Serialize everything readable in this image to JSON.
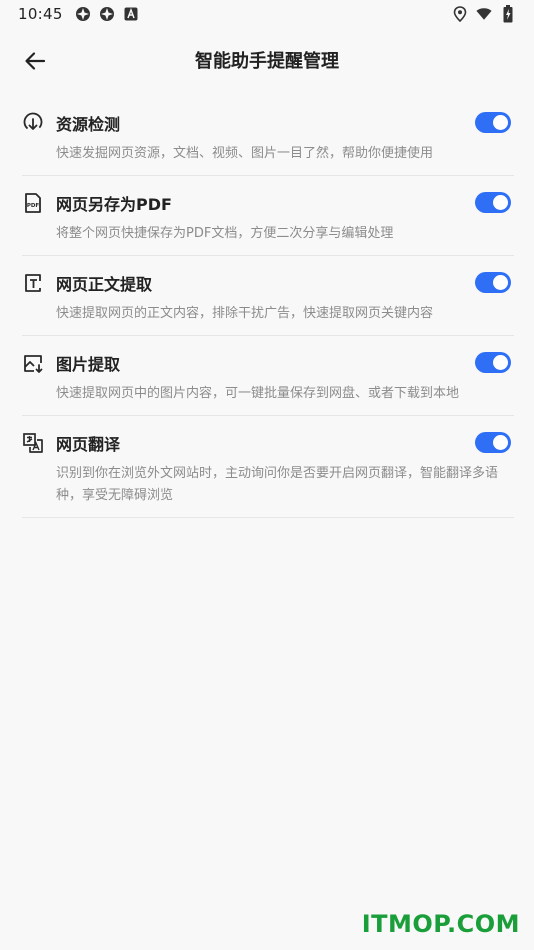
{
  "status_bar": {
    "time": "10:45",
    "left_icons": [
      "app-notification-icon",
      "app-notification-icon",
      "a-badge-icon"
    ],
    "right_icons": [
      "location-icon",
      "wifi-icon",
      "battery-icon"
    ]
  },
  "header": {
    "title": "智能助手提醒管理",
    "back_icon": "arrow-left-icon"
  },
  "features": [
    {
      "icon": "resource-detect-icon",
      "title": "资源检测",
      "desc": "快速发掘网页资源，文档、视频、图片一目了然，帮助你便捷使用",
      "enabled": true
    },
    {
      "icon": "pdf-icon",
      "title": "网页另存为PDF",
      "desc": "将整个网页快捷保存为PDF文档，方便二次分享与编辑处理",
      "enabled": true
    },
    {
      "icon": "text-extract-icon",
      "title": "网页正文提取",
      "desc": "快速提取网页的正文内容，排除干扰广告，快速提取网页关键内容",
      "enabled": true
    },
    {
      "icon": "image-extract-icon",
      "title": "图片提取",
      "desc": "快速提取网页中的图片内容，可一键批量保存到网盘、或者下载到本地",
      "enabled": true
    },
    {
      "icon": "translate-icon",
      "title": "网页翻译",
      "desc": "识别到你在浏览外文网站时，主动询问你是否要开启网页翻译，智能翻译多语种，享受无障碍浏览",
      "enabled": true
    }
  ],
  "watermark": "ITMOP.COM",
  "colors": {
    "accent": "#2f6ff5",
    "background": "#f8f8f8",
    "watermark": "#1a9e3a"
  }
}
